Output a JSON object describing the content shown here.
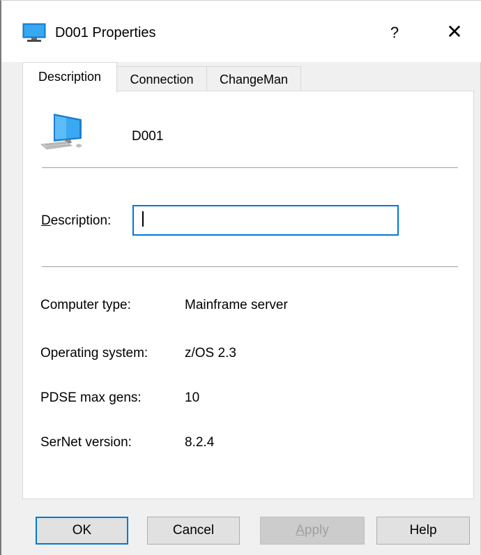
{
  "window": {
    "title": "D001 Properties",
    "help_glyph": "?",
    "close_glyph": "✕"
  },
  "tabs": [
    {
      "label": "Description",
      "active": true
    },
    {
      "label": "Connection",
      "active": false
    },
    {
      "label": "ChangeMan",
      "active": false
    }
  ],
  "device": {
    "icon": "computer-icon",
    "name": "D001"
  },
  "description_field": {
    "label_accesskey": "D",
    "label_rest": "escription:",
    "value": "",
    "placeholder": ""
  },
  "properties": [
    {
      "label": "Computer type:",
      "value": "Mainframe server"
    },
    {
      "label": "Operating system:",
      "value": "z/OS 2.3"
    },
    {
      "label": "PDSE max gens:",
      "value": "10"
    },
    {
      "label": "SerNet version:",
      "value": "8.2.4"
    }
  ],
  "buttons": {
    "ok": "OK",
    "cancel": "Cancel",
    "apply_accesskey": "A",
    "apply_rest": "pply",
    "help": "Help"
  },
  "colors": {
    "accent": "#0078d7",
    "dialog_bg": "#f0f0f0",
    "panel_bg": "#ffffff"
  }
}
